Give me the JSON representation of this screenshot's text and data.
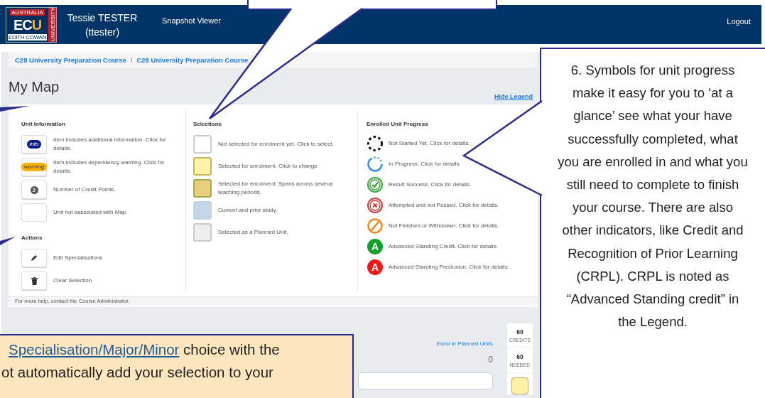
{
  "header": {
    "logo": {
      "top": "AUSTRALIA",
      "main": "EC",
      "accent": "U",
      "bottom": "EDITH COWAN",
      "side": "UNIVERSITY"
    },
    "user_name": "Tessie TESTER",
    "user_id": "(ttester)",
    "nav_link": "Snapshot Viewer",
    "logout": "Logout"
  },
  "breadcrumb": [
    "C28 University Preparation Course",
    "C28 University Preparation Course"
  ],
  "breadcrumb_separator": "/",
  "page_title": "My Map",
  "hide_legend": "Hide Legend",
  "legend": {
    "unit_information": {
      "title": "Unit Information",
      "items": [
        {
          "kind": "info",
          "badge": "info",
          "text": "Item includes additional information. Click for details."
        },
        {
          "kind": "warning",
          "badge": "warning",
          "text": "Item includes dependency warning. Click for details."
        },
        {
          "kind": "credit",
          "badge": "2",
          "text": "Number of Credit Points."
        },
        {
          "kind": "unmapped",
          "text": "Unit not associated with Map."
        }
      ]
    },
    "actions": {
      "title": "Actions",
      "items": [
        {
          "kind": "edit",
          "text": "Edit Specialisations"
        },
        {
          "kind": "clear",
          "text": "Clear Selection"
        }
      ]
    },
    "selections": {
      "title": "Selections",
      "items": [
        {
          "kind": "plain",
          "color": "#ffffff",
          "text": "Not selected for enrolment yet. Click to select."
        },
        {
          "kind": "selected",
          "color": "#fff2a6",
          "text": "Selected for enrolment. Click to change."
        },
        {
          "kind": "spanning",
          "color": "#e9cd7c",
          "text": "Selected for enrolment. Spans across several teaching periods."
        },
        {
          "kind": "current",
          "color": "#c3d5e6",
          "text": "Current and prior study."
        },
        {
          "kind": "planned",
          "color": "#eeeeee",
          "text": "Selected as a Planned Unit."
        }
      ]
    },
    "progress": {
      "title": "Enrolled Unit Progress",
      "items": [
        {
          "kind": "not_started",
          "text": "Not Started Yet. Click for details."
        },
        {
          "kind": "in_progress",
          "text": "In Progress. Click for details."
        },
        {
          "kind": "success",
          "text": "Result Success. Click for details."
        },
        {
          "kind": "failed",
          "text": "Attempted and not Passed. Click for details."
        },
        {
          "kind": "withdrawn",
          "text": "Not Finished or Withdrawn. Click for details."
        },
        {
          "kind": "credit",
          "mark": "A",
          "text": "Advanced Standing Credit. Click for details."
        },
        {
          "kind": "preclusion",
          "mark": "A",
          "text": "Advanced Standing Preclusion. Click for details."
        }
      ]
    },
    "footer": "For more help, contact the Course Administrator."
  },
  "summary": {
    "enrol_link": "Enrol in Planned Units",
    "count": "0",
    "credits": [
      {
        "value": "60",
        "label": "CREDITS"
      },
      {
        "value": "60",
        "label": "NEEDED"
      }
    ]
  },
  "callouts": {
    "symbols": "6. Symbols for unit progress make it easy for you to ‘at a glance’ see what your have successfully completed, what you are enrolled in and what you still need to complete to finish your course. There are also other indicators, like Credit and Recognition of Prior Learning (CRPL). CRPL is noted as “Advanced Standing credit” in the Legend.",
    "specialisation": {
      "link": "Specialisation/Major/Minor",
      "after": " choice with the",
      "line2": "ot automatically add your selection to your"
    }
  }
}
